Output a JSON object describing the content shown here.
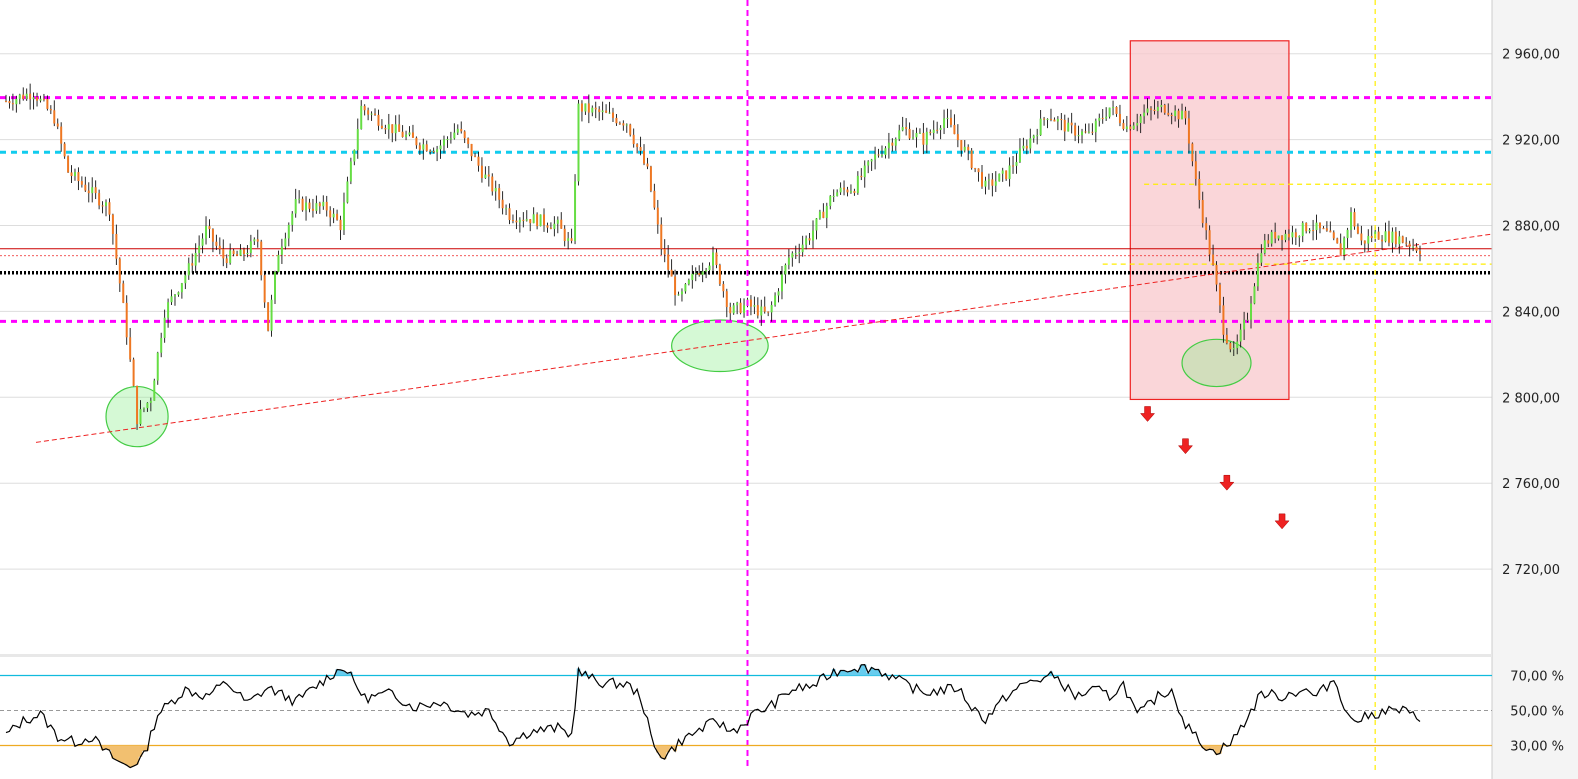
{
  "colors": {
    "up_candle": "#66dd44",
    "down_candle": "#ee7722",
    "wick": "#111111",
    "magenta": "#ff00ff",
    "cyan": "#11ccee",
    "yellow": "#ffee00",
    "red": "#ee2222",
    "dark_red": "#cc0000",
    "black": "#000000",
    "green_zone": "#88ee88",
    "pink_zone": "#f8c8cc",
    "grid": "#dddddd",
    "rsi_line": "#000000",
    "rsi_upper": "#11bbdd",
    "rsi_lower": "#eeaa22",
    "rsi_overbought_fill": "#66ccee",
    "rsi_oversold_fill": "#f2c070"
  },
  "chart_data": [
    {
      "type": "candlestick",
      "title": "",
      "xlabel": "",
      "ylabel": "",
      "ylim": [
        2680,
        2985
      ],
      "grid": true,
      "y_ticks": [
        "2 960,00",
        "2 920,00",
        "2 880,00",
        "2 840,00",
        "2 800,00",
        "2 760,00",
        "2 720,00"
      ],
      "y_tick_values": [
        2960,
        2920,
        2880,
        2840,
        2800,
        2760,
        2720
      ],
      "bars_count": 400,
      "close_path": [
        [
          0,
          2938
        ],
        [
          8,
          2942
        ],
        [
          14,
          2930
        ],
        [
          18,
          2905
        ],
        [
          25,
          2895
        ],
        [
          30,
          2888
        ],
        [
          35,
          2830
        ],
        [
          38,
          2790
        ],
        [
          42,
          2800
        ],
        [
          46,
          2840
        ],
        [
          53,
          2860
        ],
        [
          58,
          2878
        ],
        [
          63,
          2865
        ],
        [
          68,
          2866
        ],
        [
          73,
          2873
        ],
        [
          76,
          2832
        ],
        [
          79,
          2868
        ],
        [
          84,
          2890
        ],
        [
          93,
          2888
        ],
        [
          97,
          2880
        ],
        [
          103,
          2935
        ],
        [
          112,
          2925
        ],
        [
          120,
          2918
        ],
        [
          125,
          2916
        ],
        [
          131,
          2925
        ],
        [
          138,
          2905
        ],
        [
          146,
          2885
        ],
        [
          153,
          2883
        ],
        [
          160,
          2880
        ],
        [
          164,
          2870
        ],
        [
          166,
          2935
        ],
        [
          173,
          2932
        ],
        [
          180,
          2928
        ],
        [
          186,
          2905
        ],
        [
          190,
          2870
        ],
        [
          195,
          2845
        ],
        [
          200,
          2858
        ],
        [
          205,
          2865
        ],
        [
          210,
          2840
        ],
        [
          215,
          2843
        ],
        [
          221,
          2838
        ],
        [
          227,
          2865
        ],
        [
          233,
          2875
        ],
        [
          240,
          2895
        ],
        [
          246,
          2898
        ],
        [
          252,
          2912
        ],
        [
          260,
          2925
        ],
        [
          266,
          2920
        ],
        [
          272,
          2930
        ],
        [
          278,
          2915
        ],
        [
          284,
          2898
        ],
        [
          290,
          2904
        ],
        [
          296,
          2918
        ],
        [
          302,
          2932
        ],
        [
          308,
          2925
        ],
        [
          314,
          2922
        ],
        [
          320,
          2935
        ],
        [
          325,
          2926
        ],
        [
          330,
          2932
        ],
        [
          336,
          2935
        ],
        [
          342,
          2930
        ],
        [
          345,
          2900
        ],
        [
          350,
          2860
        ],
        [
          353,
          2832
        ],
        [
          356,
          2820
        ],
        [
          360,
          2838
        ],
        [
          364,
          2870
        ],
        [
          368,
          2876
        ],
        [
          373,
          2876
        ],
        [
          378,
          2880
        ],
        [
          383,
          2876
        ],
        [
          387,
          2868
        ],
        [
          390,
          2885
        ],
        [
          393,
          2872
        ],
        [
          397,
          2876
        ],
        [
          404,
          2874
        ],
        [
          410,
          2869
        ]
      ],
      "levels": [
        {
          "value": 2939.56,
          "label": "2 939,56",
          "color": "magenta",
          "style": "dash-thick"
        },
        {
          "value": 2914.08,
          "label": "2 914,08",
          "color": "cyan",
          "style": "dash-thick"
        },
        {
          "value": 2899.19,
          "label": "2 899,19",
          "color": "yellow",
          "style": "dash"
        },
        {
          "value": 2869.16,
          "label": "2 869,16",
          "color": "dark_red",
          "style": "solid-thin"
        },
        {
          "value": 2858.0,
          "label": "2 858,00",
          "color": "black",
          "style": "dot-thick"
        },
        {
          "value": 2835.34,
          "label": "2 835,34",
          "color": "magenta",
          "style": "dash-thick"
        }
      ],
      "last_price": "2 869,16",
      "trendline": {
        "from": [
          0,
          2779
        ],
        "to": [
          410,
          2876
        ],
        "color": "red"
      },
      "vertical_lines": [
        {
          "bar": 215,
          "color": "magenta"
        },
        {
          "bar": 397,
          "color": "yellow"
        }
      ],
      "highlight_zone": {
        "bar_start": 326,
        "bar_end": 372,
        "y_top": 2966,
        "y_bottom": 2799
      },
      "ellipses": [
        {
          "bar": 38,
          "value": 2791,
          "rx": 9,
          "ry": 14
        },
        {
          "bar": 207,
          "value": 2824,
          "rx": 14,
          "ry": 12
        },
        {
          "bar": 351,
          "value": 2816,
          "rx": 10,
          "ry": 11
        }
      ],
      "down_arrows": [
        {
          "bar": 331,
          "value": 2792
        },
        {
          "bar": 342,
          "value": 2777
        },
        {
          "bar": 354,
          "value": 2760
        },
        {
          "bar": 370,
          "value": 2742
        }
      ]
    },
    {
      "type": "line",
      "title": "",
      "ylim": [
        16,
        80
      ],
      "y_ticks": [
        "70,00 %",
        "50,00 %",
        "30,00 %"
      ],
      "y_tick_values": [
        70,
        50,
        30
      ],
      "upper_band": 70,
      "middle_band": 50,
      "lower_band": 30,
      "series": [
        {
          "points": [
            [
              0,
              36
            ],
            [
              5,
              44
            ],
            [
              10,
              48
            ],
            [
              15,
              35
            ],
            [
              20,
              32
            ],
            [
              25,
              35
            ],
            [
              28,
              28
            ],
            [
              33,
              20
            ],
            [
              36,
              18
            ],
            [
              40,
              24
            ],
            [
              44,
              48
            ],
            [
              52,
              62
            ],
            [
              58,
              58
            ],
            [
              64,
              66
            ],
            [
              70,
              54
            ],
            [
              76,
              63
            ],
            [
              84,
              55
            ],
            [
              94,
              70
            ],
            [
              98,
              75
            ],
            [
              104,
              57
            ],
            [
              112,
              60
            ],
            [
              118,
              52
            ],
            [
              126,
              55
            ],
            [
              134,
              48
            ],
            [
              140,
              50
            ],
            [
              146,
              32
            ],
            [
              152,
              38
            ],
            [
              160,
              40
            ],
            [
              164,
              36
            ],
            [
              166,
              72
            ],
            [
              172,
              66
            ],
            [
              180,
              65
            ],
            [
              184,
              58
            ],
            [
              188,
              28
            ],
            [
              191,
              24
            ],
            [
              196,
              33
            ],
            [
              202,
              40
            ],
            [
              206,
              44
            ],
            [
              210,
              38
            ],
            [
              214,
              42
            ],
            [
              216,
              47
            ],
            [
              222,
              53
            ],
            [
              228,
              62
            ],
            [
              234,
              64
            ],
            [
              240,
              72
            ],
            [
              246,
              75
            ],
            [
              252,
              74
            ],
            [
              258,
              68
            ],
            [
              266,
              60
            ],
            [
              276,
              63
            ],
            [
              280,
              52
            ],
            [
              284,
              45
            ],
            [
              290,
              58
            ],
            [
              296,
              66
            ],
            [
              304,
              70
            ],
            [
              310,
              58
            ],
            [
              316,
              62
            ],
            [
              320,
              58
            ],
            [
              324,
              65
            ],
            [
              328,
              47
            ],
            [
              334,
              58
            ],
            [
              338,
              62
            ],
            [
              342,
              42
            ],
            [
              346,
              33
            ],
            [
              350,
              26
            ],
            [
              355,
              31
            ],
            [
              360,
              46
            ],
            [
              364,
              60
            ],
            [
              370,
              58
            ],
            [
              376,
              62
            ],
            [
              380,
              58
            ],
            [
              385,
              68
            ],
            [
              390,
              44
            ],
            [
              394,
              46
            ],
            [
              400,
              50
            ],
            [
              405,
              50
            ],
            [
              410,
              45
            ]
          ]
        }
      ]
    }
  ]
}
